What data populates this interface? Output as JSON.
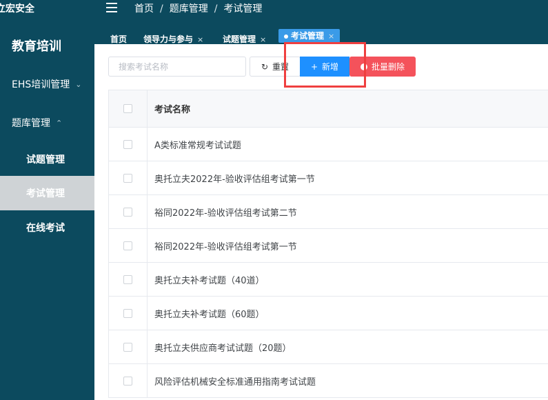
{
  "sidebar": {
    "brand": "立宏安全",
    "module_title": "教育培训",
    "menu": [
      {
        "label": "EHS培训管理",
        "chevron": "chevron-down"
      },
      {
        "label": "题库管理",
        "chevron": "chevron-up"
      }
    ],
    "submenu": [
      {
        "label": "试题管理",
        "active": false
      },
      {
        "label": "考试管理",
        "active": true
      },
      {
        "label": "在线考试",
        "active": false
      }
    ]
  },
  "header": {
    "breadcrumb": [
      "首页",
      "题库管理",
      "考试管理"
    ]
  },
  "tabs": [
    {
      "label": "首页",
      "closable": false
    },
    {
      "label": "领导力与参与",
      "closable": true
    },
    {
      "label": "试题管理",
      "closable": true
    },
    {
      "label": "考试管理",
      "closable": true,
      "active": true
    }
  ],
  "toolbar": {
    "search_placeholder": "搜索考试名称",
    "reset_label": "重置",
    "add_label": "新增",
    "batch_delete_label": "批量删除"
  },
  "table": {
    "column_header": "考试名称",
    "rows": [
      "A类标准常规考试试题",
      "奥托立夫2022年-验收评估组考试第一节",
      "裕同2022年-验收评估组考试第二节",
      "裕同2022年-验收评估组考试第一节",
      "奥托立夫补考试题（40道）",
      "奥托立夫补考试题（60题）",
      "奥托立夫供应商考试试题（20题）",
      "风险评估机械安全标准通用指南考试试题"
    ]
  },
  "colors": {
    "sidebar_bg": "#0c4a5e",
    "primary": "#1e90ff",
    "danger": "#f4525b",
    "highlight": "#ef3f3f"
  }
}
